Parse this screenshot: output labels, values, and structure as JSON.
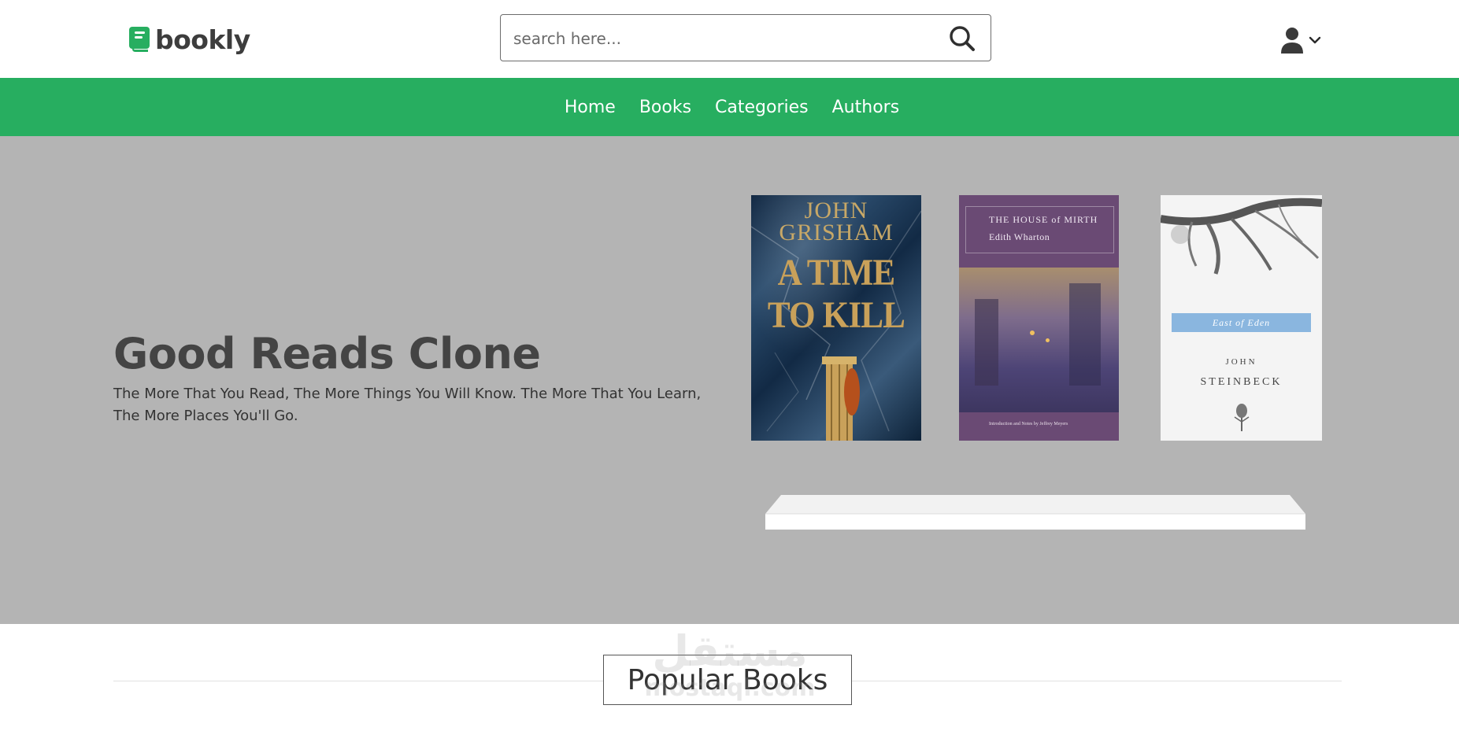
{
  "header": {
    "logo_text": "bookly",
    "search_placeholder": "search here...",
    "accent_color": "#27ae60"
  },
  "nav": {
    "items": [
      {
        "label": "Home"
      },
      {
        "label": "Books"
      },
      {
        "label": "Categories"
      },
      {
        "label": "Authors"
      }
    ]
  },
  "hero": {
    "title": "Good Reads Clone",
    "subtitle": "The More That You Read, The More Things You Will Know. The More That You Learn, The More Places You'll Go.",
    "books": [
      {
        "author_line_1": "JOHN",
        "author_line_2": "GRISHAM",
        "title_line_1": "A TIME",
        "title_line_2": "TO KILL"
      },
      {
        "title": "THE HOUSE of MIRTH",
        "author": "Edith Wharton",
        "footer": "Introduction and Notes by Jeffrey Meyers"
      },
      {
        "title": "East of Eden",
        "author_line_1": "JOHN",
        "author_line_2": "STEINBECK"
      }
    ]
  },
  "popular": {
    "title": "Popular Books"
  },
  "watermark": {
    "arabic": "مستقل",
    "latin": "mostaql.com"
  },
  "colors": {
    "nav_bg": "#27ae60",
    "hero_bg": "#b4b4b4",
    "heading": "#444444"
  }
}
